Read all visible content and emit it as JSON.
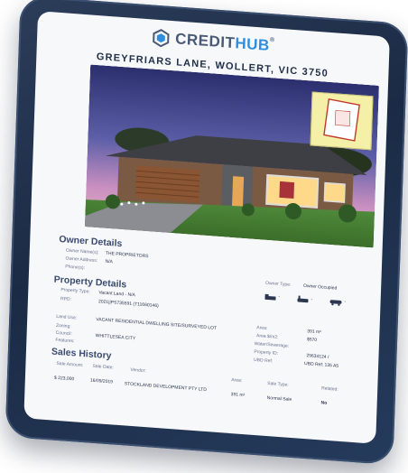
{
  "brand": {
    "credit": "CREDIT",
    "hub": "HUB",
    "registered": "®"
  },
  "address": "GREYFRIARS LANE, WOLLERT, VIC 3750",
  "owner_details": {
    "title": "Owner Details",
    "owner_names_label": "Owner Name(s):",
    "owner_names_value": "THE PROPRIETORS",
    "owner_address_label": "Owner Address:",
    "owner_address_value": "N/A",
    "phones_label": "Phone(s):"
  },
  "owner_type": {
    "label": "Owner Type:",
    "value": "Owner Occupied"
  },
  "features": {
    "bed_icon": "bed-icon",
    "bed_value": "-",
    "bath_icon": "bath-icon",
    "bath_value": "-",
    "car_icon": "car-icon",
    "car_value": "-"
  },
  "property_details": {
    "title": "Property Details",
    "property_type_label": "Property Type:",
    "property_type_value": "Vacant Land - N/A",
    "rpd_label": "RPD:",
    "rpd_value": "2021||PS735591 (T11660146)",
    "land_use_label": "Land Use:",
    "land_use_value": "VACANT RESIDENTIAL DWELLING SITE/SURVEYED LOT",
    "zoning_label": "Zoning:",
    "council_label": "Council:",
    "council_value": "WHITTLESEA CITY",
    "features_label": "Features:",
    "area_label": "Area:",
    "area_value": "391 m²",
    "area_sqm_label": "Area $/m2:",
    "area_sqm_value": "$570",
    "water_label": "Water/Sewerage:",
    "property_id_label": "Property ID:",
    "property_id_value": "29634124 /",
    "ubd_label": "UBD Ref:",
    "ubd_value": "UBD Ref: 135 A5"
  },
  "sales_history": {
    "title": "Sales History",
    "headers": {
      "amount": "Sale Amount:",
      "date": "Sale Date:",
      "vendor": "Vendor:",
      "area": "Area:",
      "type": "Sale Type:",
      "related": "Related:"
    },
    "row": {
      "amount": "$ 223,000",
      "date": "16/09/2019",
      "vendor": "STOCKLAND DEVELOPMENT PTY LTD",
      "area": "391 m²",
      "type": "Normal Sale",
      "related": "No"
    }
  },
  "colors": {
    "brand_dark": "#4a5a75",
    "brand_blue": "#2f8ee0",
    "frame": "#1f2f4a"
  }
}
